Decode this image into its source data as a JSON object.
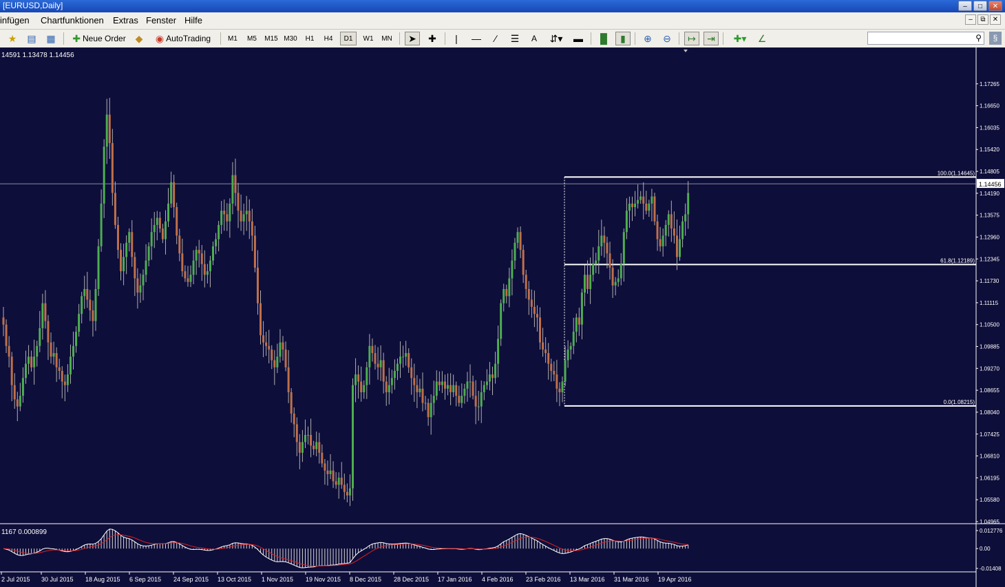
{
  "window": {
    "title": "[EURUSD,Daily]"
  },
  "menu": [
    "infügen",
    "Chartfunktionen",
    "Extras",
    "Fenster",
    "Hilfe"
  ],
  "toolbar": {
    "new_order": "Neue Order",
    "auto_trading": "AutoTrading",
    "timeframes": [
      "M1",
      "M5",
      "M15",
      "M30",
      "H1",
      "H4",
      "D1",
      "W1",
      "MN"
    ],
    "active_timeframe": "D1",
    "text_tool": "A",
    "search_placeholder": ""
  },
  "chart_data": {
    "type": "candlestick",
    "symbol": "EURUSD",
    "timeframe": "Daily",
    "ohlc_header": "14591 1.13478 1.14456",
    "background": "#0e0e3a",
    "bull_color": "#4caf50",
    "bear_color": "#c0704a",
    "current_price": "1.14456",
    "ylim": [
      1.04965,
      1.17725
    ],
    "y_ticks": [
      "1.17265",
      "1.16650",
      "1.16035",
      "1.15420",
      "1.14805",
      "1.14190",
      "1.13575",
      "1.12960",
      "1.12345",
      "1.11730",
      "1.11115",
      "1.10500",
      "1.09885",
      "1.09270",
      "1.08655",
      "1.08040",
      "1.07425",
      "1.06810",
      "1.06195",
      "1.05580",
      "1.04965"
    ],
    "x_labels": [
      "2 Jul 2015",
      "30 Jul 2015",
      "18 Aug 2015",
      "6 Sep 2015",
      "24 Sep 2015",
      "13 Oct 2015",
      "1 Nov 2015",
      "19 Nov 2015",
      "8 Dec 2015",
      "28 Dec 2015",
      "17 Jan 2016",
      "4 Feb 2016",
      "23 Feb 2016",
      "13 Mar 2016",
      "31 Mar 2016",
      "19 Apr 2016"
    ],
    "fibonacci": [
      {
        "level": "100.0",
        "price": 1.14645,
        "label": "100.0(1.14645)"
      },
      {
        "level": "61.8",
        "price": 1.12189,
        "label": "61.8(1.12189)"
      },
      {
        "level": "0.0",
        "price": 1.08215,
        "label": "0.0(1.08215)"
      }
    ],
    "closes": [
      1.105,
      1.099,
      1.096,
      1.088,
      1.084,
      1.082,
      1.085,
      1.09,
      1.094,
      1.096,
      1.093,
      1.096,
      1.099,
      1.104,
      1.111,
      1.106,
      1.1,
      1.096,
      1.097,
      1.093,
      1.092,
      1.089,
      1.088,
      1.091,
      1.096,
      1.099,
      1.103,
      1.108,
      1.113,
      1.115,
      1.112,
      1.109,
      1.106,
      1.115,
      1.127,
      1.139,
      1.155,
      1.164,
      1.156,
      1.142,
      1.133,
      1.126,
      1.12,
      1.124,
      1.128,
      1.131,
      1.124,
      1.118,
      1.114,
      1.116,
      1.119,
      1.123,
      1.127,
      1.131,
      1.133,
      1.135,
      1.132,
      1.129,
      1.134,
      1.139,
      1.145,
      1.138,
      1.13,
      1.125,
      1.12,
      1.118,
      1.117,
      1.119,
      1.123,
      1.126,
      1.125,
      1.122,
      1.119,
      1.12,
      1.123,
      1.127,
      1.129,
      1.133,
      1.137,
      1.136,
      1.134,
      1.139,
      1.147,
      1.142,
      1.137,
      1.134,
      1.136,
      1.137,
      1.134,
      1.13,
      1.121,
      1.111,
      1.102,
      1.1,
      1.099,
      1.098,
      1.095,
      1.093,
      1.096,
      1.1,
      1.098,
      1.093,
      1.086,
      1.08,
      1.077,
      1.072,
      1.069,
      1.072,
      1.074,
      1.074,
      1.071,
      1.07,
      1.072,
      1.069,
      1.066,
      1.064,
      1.063,
      1.064,
      1.061,
      1.06,
      1.062,
      1.06,
      1.058,
      1.057,
      1.059,
      1.088,
      1.091,
      1.089,
      1.086,
      1.088,
      1.093,
      1.099,
      1.097,
      1.094,
      1.093,
      1.095,
      1.089,
      1.086,
      1.088,
      1.09,
      1.092,
      1.094,
      1.096,
      1.096,
      1.097,
      1.093,
      1.09,
      1.088,
      1.086,
      1.087,
      1.083,
      1.083,
      1.079,
      1.083,
      1.085,
      1.089,
      1.088,
      1.089,
      1.087,
      1.088,
      1.086,
      1.088,
      1.085,
      1.083,
      1.085,
      1.087,
      1.089,
      1.089,
      1.085,
      1.082,
      1.082,
      1.086,
      1.088,
      1.089,
      1.091,
      1.09,
      1.094,
      1.101,
      1.111,
      1.115,
      1.113,
      1.118,
      1.123,
      1.128,
      1.131,
      1.126,
      1.119,
      1.115,
      1.112,
      1.11,
      1.108,
      1.107,
      1.1,
      1.098,
      1.097,
      1.094,
      1.092,
      1.091,
      1.087,
      1.086,
      1.089,
      1.095,
      1.098,
      1.099,
      1.103,
      1.107,
      1.105,
      1.114,
      1.119,
      1.115,
      1.119,
      1.122,
      1.123,
      1.127,
      1.13,
      1.128,
      1.125,
      1.121,
      1.116,
      1.117,
      1.118,
      1.122,
      1.131,
      1.137,
      1.139,
      1.138,
      1.139,
      1.14,
      1.141,
      1.139,
      1.137,
      1.139,
      1.141,
      1.134,
      1.129,
      1.127,
      1.13,
      1.133,
      1.136,
      1.132,
      1.13,
      1.124,
      1.129,
      1.134,
      1.136,
      1.142
    ]
  },
  "macd": {
    "label": "1167 0.000899",
    "y_ticks": [
      "0.012776",
      "0.00",
      "-0.01408"
    ]
  }
}
